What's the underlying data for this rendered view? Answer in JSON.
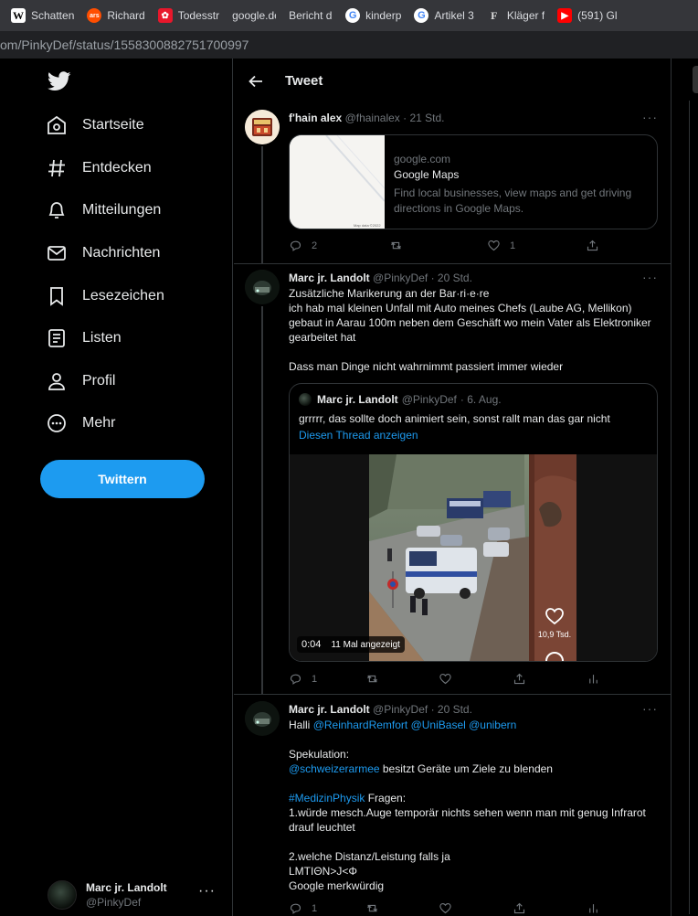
{
  "bookmarks": [
    {
      "label": "Schatten",
      "icon": "wikipedia-icon",
      "color": "#ffffff",
      "glyph": "W"
    },
    {
      "label": "Richard",
      "icon": "ars-icon",
      "color": "#ff4e00",
      "glyph": "ars"
    },
    {
      "label": "Todesstr",
      "icon": "red-paw-icon",
      "color": "#e8172b",
      "glyph": "✿"
    },
    {
      "label": "google.de/u",
      "icon": "",
      "color": "",
      "glyph": ""
    },
    {
      "label": "Bericht der",
      "icon": "",
      "color": "",
      "glyph": ""
    },
    {
      "label": "kinderp",
      "icon": "google-icon",
      "color": "#ffffff",
      "glyph": "G"
    },
    {
      "label": "Artikel 3",
      "icon": "google-icon",
      "color": "#ffffff",
      "glyph": "G"
    },
    {
      "label": "Kläger f",
      "icon": "faz-icon",
      "color": "#ffffff",
      "glyph": "F"
    },
    {
      "label": "(591) Gl",
      "icon": "youtube-icon",
      "color": "#ff0000",
      "glyph": "▶"
    }
  ],
  "address": "om/PinkyDef/status/1558300882751700997",
  "nav": {
    "items": [
      {
        "label": "Startseite",
        "icon": "home-icon"
      },
      {
        "label": "Entdecken",
        "icon": "hashtag-icon"
      },
      {
        "label": "Mitteilungen",
        "icon": "bell-icon"
      },
      {
        "label": "Nachrichten",
        "icon": "mail-icon"
      },
      {
        "label": "Lesezeichen",
        "icon": "bookmark-icon"
      },
      {
        "label": "Listen",
        "icon": "list-icon"
      },
      {
        "label": "Profil",
        "icon": "profile-icon"
      },
      {
        "label": "Mehr",
        "icon": "more-circle-icon"
      }
    ],
    "tweet_button": "Twittern",
    "account": {
      "name": "Marc jr. Landolt",
      "handle": "@PinkyDef",
      "more": "···"
    }
  },
  "header": {
    "title": "Tweet"
  },
  "tweets": [
    {
      "name": "f'hain alex",
      "handle": "@fhainalex",
      "time": "· 21 Std.",
      "card": {
        "domain": "google.com",
        "title": "Google Maps",
        "description": "Find local businesses, view maps and get driving directions in Google Maps.",
        "map_credit": "Map data ©2022"
      },
      "actions": {
        "replies": "2",
        "retweets": "",
        "likes": "1"
      }
    },
    {
      "name": "Marc jr. Landolt",
      "handle": "@PinkyDef",
      "time": "· 20 Std.",
      "lines": [
        "Zusätzliche Marikerung an der Bar·ri·e·re",
        "ich hab mal kleinen Unfall mit Auto meines Chefs (Laube AG, Mellikon)",
        "gebaut in Aarau 100m neben dem Geschäft wo mein Vater als Elektroniker",
        "gearbeitet hat",
        "",
        "Dass man Dinge nicht wahrnimmt passiert immer wieder"
      ],
      "quote": {
        "name": "Marc jr. Landolt",
        "handle": "@PinkyDef",
        "time": "· 6. Aug.",
        "text": "grrrrr, das sollte doch animiert sein, sonst rallt man das gar nicht",
        "show_thread": "Diesen Thread anzeigen",
        "video": {
          "time": "0:04",
          "views": "11 Mal angezeigt",
          "likes": "10,9 Tsd."
        }
      },
      "actions": {
        "replies": "1",
        "retweets": "",
        "likes": ""
      }
    },
    {
      "name": "Marc jr. Landolt",
      "handle": "@PinkyDef",
      "time": "· 20 Std.",
      "hallo": "Halli",
      "mentions": "@ReinhardRemfort @UniBasel @unibern",
      "spekulation": "Spekulation:",
      "armee_link": "@schweizerarmee",
      "armee_text": " besitzt Geräte um Ziele zu blenden",
      "hashtag": "#MedizinPhysik",
      "hashtag_text": " Fragen:",
      "q1a": "1.würde mesch.Auge temporär nichts sehen wenn man mit genug Infrarot",
      "q1b": "drauf leuchtet",
      "q2": "2.welche Distanz/Leistung falls ja",
      "formula": "LMTIΘN>J<Φ",
      "last": "Google merkwürdig",
      "actions": {
        "replies": "1",
        "retweets": "",
        "likes": ""
      }
    }
  ]
}
